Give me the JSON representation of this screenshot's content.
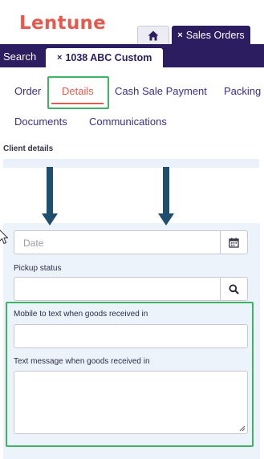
{
  "brand": {
    "logo_text": "Lentune",
    "logo_color": "#e65a4d"
  },
  "top_tabs": [
    {
      "icon": "home-icon"
    },
    {
      "label": "Sales Orders",
      "close": "×"
    }
  ],
  "navbar": {
    "search_label": "Search",
    "record_tab_label": "1038 ABC Custom",
    "record_tab_close": "×",
    "bg_color": "#2b1d5f"
  },
  "subtabs": [
    {
      "label": "Order",
      "active": false
    },
    {
      "label": "Details",
      "active": true
    },
    {
      "label": "Cash Sale Payment",
      "active": false
    },
    {
      "label": "Packing s",
      "active": false
    },
    {
      "label": "Documents",
      "active": false
    },
    {
      "label": "Communications",
      "active": false
    }
  ],
  "section": {
    "title": "Client details"
  },
  "form": {
    "date": {
      "placeholder": "Date",
      "icon": "calendar-icon"
    },
    "pickup_status": {
      "label": "Pickup status",
      "value": "",
      "icon": "search-icon"
    },
    "mobile_to_text": {
      "label": "Mobile to text when goods received in",
      "value": ""
    },
    "text_message": {
      "label": "Text message when goods received in",
      "value": ""
    }
  },
  "annotations": {
    "arrow_color": "#1f4e6e",
    "highlight_color": "#3cb464"
  }
}
